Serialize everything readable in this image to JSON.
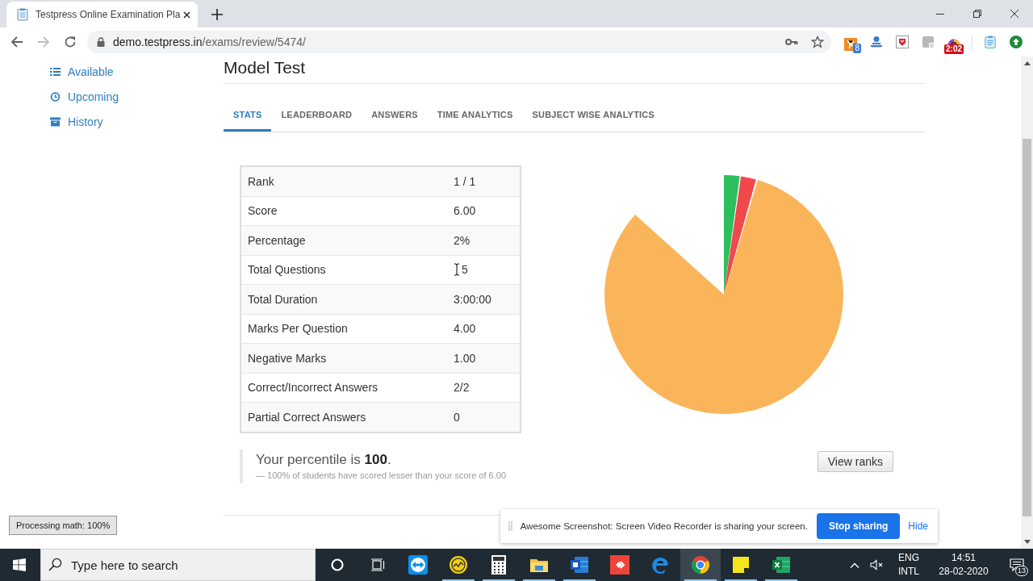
{
  "browser": {
    "tab": {
      "title": "Testpress Online Examination Pla"
    },
    "address": {
      "host": "demo.testpress.in",
      "path": "/exams/review/5474/"
    },
    "extension_badges": [
      "8",
      "2:02"
    ]
  },
  "sidebar": {
    "items": [
      {
        "label": "Available"
      },
      {
        "label": "Upcoming"
      },
      {
        "label": "History"
      }
    ]
  },
  "exam": {
    "title": "Model Test"
  },
  "tabs": [
    {
      "label": "STATS",
      "selected": true
    },
    {
      "label": "LEADERBOARD",
      "selected": false
    },
    {
      "label": "ANSWERS",
      "selected": false
    },
    {
      "label": "TIME ANALYTICS",
      "selected": false
    },
    {
      "label": "SUBJECT WISE ANALYTICS",
      "selected": false
    }
  ],
  "stats": {
    "rows": [
      {
        "label": "Rank",
        "value": "1 / 1",
        "hovered": false
      },
      {
        "label": "Score",
        "value": "6.00",
        "hovered": false
      },
      {
        "label": "Percentage",
        "value": "2%",
        "hovered": false
      },
      {
        "label": "Total Questions",
        "value": "5",
        "hovered": true
      },
      {
        "label": "Total Duration",
        "value": "3:00:00",
        "hovered": false
      },
      {
        "label": "Marks Per Question",
        "value": "4.00",
        "hovered": false
      },
      {
        "label": "Negative Marks",
        "value": "1.00",
        "hovered": false
      },
      {
        "label": "Correct/Incorrect Answers",
        "value": "2/2",
        "hovered": false
      },
      {
        "label": "Partial Correct Answers",
        "value": "0",
        "hovered": false
      }
    ]
  },
  "percentile": {
    "text": "Your percentile is **100**.",
    "note": "— 100% of students have scored lesser than your score of 6.00",
    "button": "View ranks"
  },
  "math_status": "Processing math: 100%",
  "share_bar": {
    "message": "Awesome Screenshot: Screen Video Recorder is sharing your screen.",
    "stop_button": "Stop sharing",
    "hide_link": "Hide"
  },
  "taskbar": {
    "search_placeholder": "Type here to search",
    "apps": [
      {
        "running": false,
        "selected": false
      },
      {
        "running": true,
        "selected": false
      },
      {
        "running": true,
        "selected": false
      },
      {
        "running": true,
        "selected": false
      },
      {
        "running": true,
        "selected": false
      },
      {
        "running": false,
        "selected": false
      },
      {
        "running": false,
        "selected": false
      },
      {
        "running": true,
        "selected": true
      },
      {
        "running": true,
        "selected": false
      },
      {
        "running": true,
        "selected": false
      }
    ],
    "language": "ENG",
    "keyboard": "INTL",
    "time": "14:51",
    "date": "28-02-2020",
    "notifications": "13"
  }
}
